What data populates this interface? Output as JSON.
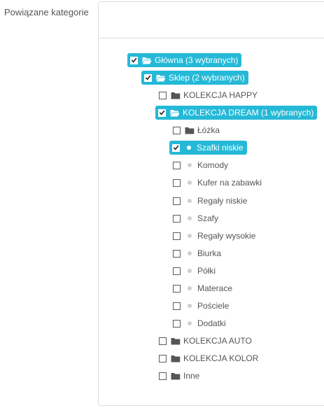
{
  "field": {
    "label": "Powiązane kategorie"
  },
  "colors": {
    "selected_bg": "#25b9d7",
    "folder_dark": "#555555",
    "leaf_dot": "#cfcfcf"
  },
  "tree": {
    "nodes": [
      {
        "label": "Główna (3 wybranych)",
        "checked": true,
        "selected": true,
        "icon": "folder-open-icon"
      },
      {
        "label": "Sklep (2 wybranych)",
        "checked": true,
        "selected": true,
        "icon": "folder-open-icon"
      },
      {
        "label": "KOLEKCJA HAPPY",
        "checked": false,
        "selected": false,
        "icon": "folder-closed-icon"
      },
      {
        "label": "KOLEKCJA DREAM (1 wybranych)",
        "checked": true,
        "selected": true,
        "icon": "folder-open-icon"
      },
      {
        "label": "Łóżka",
        "checked": false,
        "selected": false,
        "icon": "folder-closed-icon"
      },
      {
        "label": "Szafki niskie",
        "checked": true,
        "selected": true,
        "icon": "dot-icon"
      },
      {
        "label": "Komody",
        "checked": false,
        "selected": false,
        "icon": "dot-icon"
      },
      {
        "label": "Kufer na zabawki",
        "checked": false,
        "selected": false,
        "icon": "dot-icon"
      },
      {
        "label": "Regały niskie",
        "checked": false,
        "selected": false,
        "icon": "dot-icon"
      },
      {
        "label": "Szafy",
        "checked": false,
        "selected": false,
        "icon": "dot-icon"
      },
      {
        "label": "Regały wysokie",
        "checked": false,
        "selected": false,
        "icon": "dot-icon"
      },
      {
        "label": "Biurka",
        "checked": false,
        "selected": false,
        "icon": "dot-icon"
      },
      {
        "label": "Półki",
        "checked": false,
        "selected": false,
        "icon": "dot-icon"
      },
      {
        "label": "Materace",
        "checked": false,
        "selected": false,
        "icon": "dot-icon"
      },
      {
        "label": "Pościele",
        "checked": false,
        "selected": false,
        "icon": "dot-icon"
      },
      {
        "label": "Dodatki",
        "checked": false,
        "selected": false,
        "icon": "dot-icon"
      },
      {
        "label": "KOLEKCJA AUTO",
        "checked": false,
        "selected": false,
        "icon": "folder-closed-icon"
      },
      {
        "label": "KOLEKCJA KOLOR",
        "checked": false,
        "selected": false,
        "icon": "folder-closed-icon"
      },
      {
        "label": "Inne",
        "checked": false,
        "selected": false,
        "icon": "folder-closed-icon"
      }
    ]
  }
}
